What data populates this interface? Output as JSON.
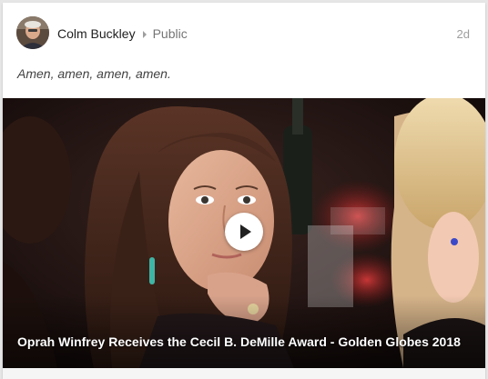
{
  "post": {
    "author_name": "Colm Buckley",
    "visibility": "Public",
    "timestamp": "2d",
    "text": "Amen, amen, amen, amen."
  },
  "video": {
    "title": "Oprah Winfrey Receives the Cecil B. DeMille Award - Golden Globes 2018"
  },
  "icons": {
    "avatar": "user-avatar-photo",
    "caret": "caret-right-icon",
    "play": "play-icon"
  },
  "colors": {
    "author": "#212121",
    "secondary": "#757575",
    "timestamp": "#9e9e9e",
    "play_button": "#ffffff"
  }
}
